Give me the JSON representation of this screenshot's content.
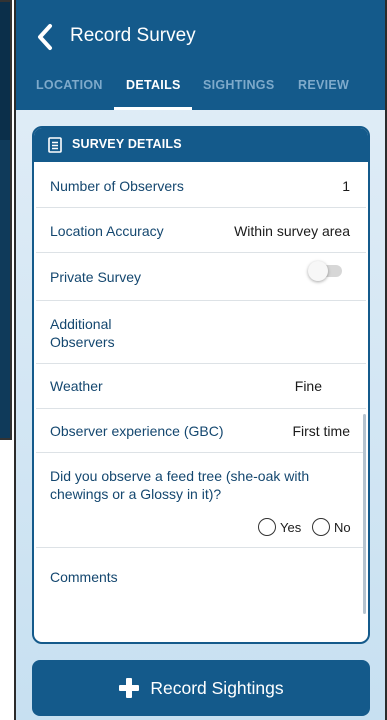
{
  "app": {
    "title": "Record Survey"
  },
  "tabs": [
    {
      "label": "LOCATION"
    },
    {
      "label": "DETAILS"
    },
    {
      "label": "SIGHTINGS"
    },
    {
      "label": "REVIEW"
    }
  ],
  "active_tab": "DETAILS",
  "card": {
    "title": "SURVEY DETAILS",
    "icon": "document-icon",
    "rows": [
      {
        "label": "Number of Observers",
        "value": "1"
      },
      {
        "label": "Location Accuracy",
        "value": "Within survey area"
      },
      {
        "label": "Private Survey",
        "toggle": false
      },
      {
        "label_lines": [
          "Additional",
          "Observers"
        ],
        "value": ""
      },
      {
        "label": "Weather",
        "value": "Fine"
      },
      {
        "label": "Observer experience (GBC)",
        "value": "First time"
      },
      {
        "label_lines": [
          "Did you observe a feed tree (she-oak with",
          "chewings or a Glossy in it)?"
        ],
        "options": [
          "Yes",
          "No"
        ]
      },
      {
        "label": "Comments",
        "value": ""
      }
    ]
  },
  "actions": {
    "record_sightings": "Record Sightings"
  },
  "colors": {
    "primary": "#145a8b",
    "tab_inactive": "#7eaacb",
    "label": "#14476f"
  }
}
